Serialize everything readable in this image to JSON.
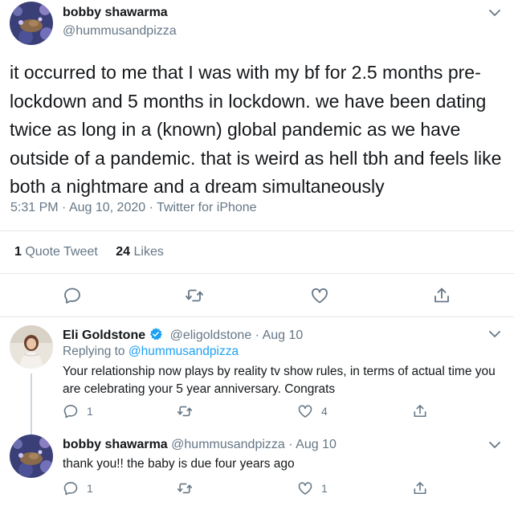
{
  "main": {
    "author_name": "bobby shawarma",
    "author_handle": "@hummusandpizza",
    "text": "it occurred to me that I was with my bf for 2.5 months pre-lockdown and 5 months in lockdown. we have been dating twice as long in a (known) global pandemic as we have outside of a pandemic. that is weird as hell tbh and feels like both a nightmare and a dream simultaneously",
    "time": "5:31 PM",
    "date": "Aug 10, 2020",
    "client": "Twitter for iPhone",
    "quote_count": "1",
    "quote_label": "Quote Tweet",
    "like_count": "24",
    "like_label": "Likes"
  },
  "replies": [
    {
      "author_name": "Eli Goldstone",
      "author_handle": "@eligoldstone",
      "date": "Aug 10",
      "replying_prefix": "Replying to",
      "replying_to": "@hummusandpizza",
      "text": "Your relationship now plays by reality tv show rules, in terms of actual time you are celebrating your 5 year anniversary. Congrats",
      "reply_count": "1",
      "like_count": "4"
    },
    {
      "author_name": "bobby shawarma",
      "author_handle": "@hummusandpizza",
      "date": "Aug 10",
      "text": "thank you!! the baby is due four years ago",
      "reply_count": "1",
      "like_count": "1"
    }
  ],
  "separator": "·",
  "colors": {
    "accent": "#1da1f2",
    "secondary_text": "#657786",
    "divider": "#e1e8ed",
    "thread_line": "#ccd6dd"
  },
  "icons": {
    "reply": "reply-icon",
    "retweet": "retweet-icon",
    "like": "heart-icon",
    "share": "share-icon",
    "more": "chevron-down-icon",
    "verified": "verified-badge-icon"
  }
}
